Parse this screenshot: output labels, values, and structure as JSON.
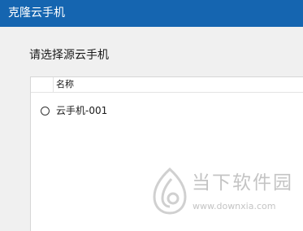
{
  "window": {
    "title": "克隆云手机",
    "title_bar_color": "#1565b0"
  },
  "prompt": "请选择源云手机",
  "list": {
    "column_header": "名称",
    "rows": [
      {
        "label": "云手机-001",
        "selected": false
      }
    ]
  },
  "watermark": {
    "title": "当下软件园",
    "url": "www.downxia.com"
  }
}
